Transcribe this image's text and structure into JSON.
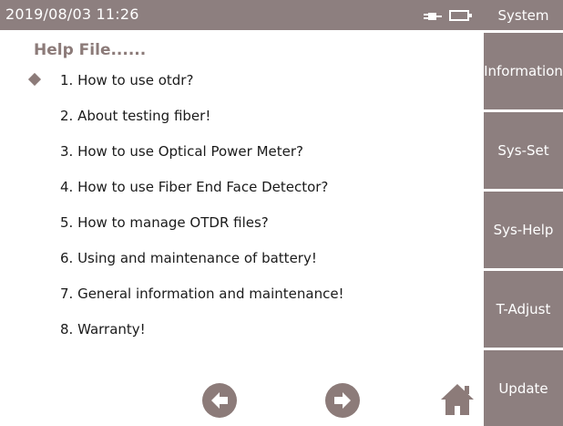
{
  "status": {
    "datetime": "2019/08/03  11:26",
    "plug_icon": "power-plug-icon",
    "battery_icon": "battery-icon"
  },
  "help": {
    "title": "Help File......",
    "items": [
      {
        "label": "1. How to use otdr?",
        "selected": true
      },
      {
        "label": "2. About testing fiber!",
        "selected": false
      },
      {
        "label": "3. How to use Optical Power Meter?",
        "selected": false
      },
      {
        "label": "4. How to use Fiber End Face Detector?",
        "selected": false
      },
      {
        "label": "5. How to manage OTDR files?",
        "selected": false
      },
      {
        "label": "6. Using and maintenance of battery!",
        "selected": false
      },
      {
        "label": "7. General information and maintenance!",
        "selected": false
      },
      {
        "label": "8. Warranty!",
        "selected": false
      }
    ]
  },
  "navigation": {
    "prev_icon": "arrow-left-icon",
    "next_icon": "arrow-right-icon",
    "home_icon": "home-icon"
  },
  "sidebar": {
    "header": "System",
    "buttons": [
      "Information",
      "Sys-Set",
      "Sys-Help",
      "T-Adjust",
      "Update"
    ]
  },
  "colors": {
    "accent": "#8d7f7f",
    "marker": "#8c7b79",
    "text": "#1b1b1b",
    "background": "#ffffff"
  }
}
